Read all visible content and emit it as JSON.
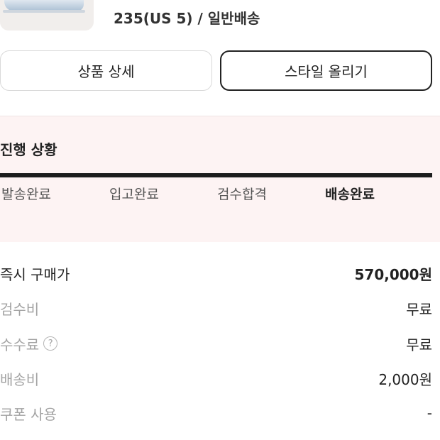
{
  "product": {
    "option_text": "235(US 5) / 일반배송"
  },
  "actions": {
    "detail_label": "상품 상세",
    "style_label": "스타일 올리기"
  },
  "progress": {
    "title": "진행 상황",
    "steps": [
      {
        "label": "발송완료",
        "active": false
      },
      {
        "label": "입고완료",
        "active": false
      },
      {
        "label": "검수합격",
        "active": false
      },
      {
        "label": "배송완료",
        "active": true
      }
    ],
    "bar_fill": 1.0
  },
  "price": {
    "rows": [
      {
        "label": "즉시 구매가",
        "value": "570,000원"
      },
      {
        "label": "검수비",
        "value": "무료"
      },
      {
        "label": "수수료",
        "value": "무료",
        "help_icon": "question-circle-icon",
        "help_glyph": "?"
      },
      {
        "label": "배송비",
        "value": "2,000원"
      },
      {
        "label": "쿠폰 사용",
        "value": "-"
      }
    ]
  },
  "colors": {
    "progress_background": "#fdf3f3",
    "progress_bar": "#1c1c1c",
    "muted_text": "#a3a3a3",
    "primary_text": "#222222"
  }
}
